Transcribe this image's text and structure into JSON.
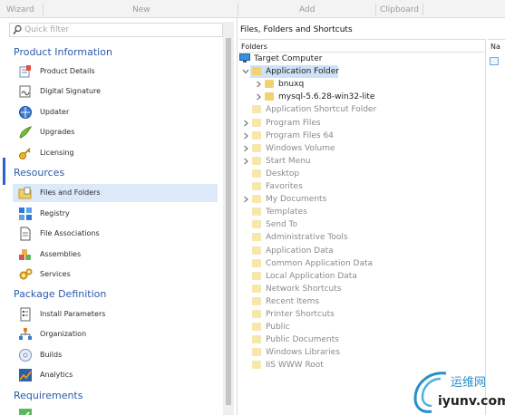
{
  "ribbon": {
    "groups": [
      "Wizard",
      "New",
      "Add",
      "Clipboard"
    ]
  },
  "sidebar": {
    "filter_placeholder": "Quick filter",
    "sections": [
      {
        "title": "Product Information",
        "items": [
          {
            "label": "Product Details",
            "icon": "product-details-icon"
          },
          {
            "label": "Digital Signature",
            "icon": "digital-signature-icon"
          },
          {
            "label": "Updater",
            "icon": "updater-icon"
          },
          {
            "label": "Upgrades",
            "icon": "upgrades-icon"
          },
          {
            "label": "Licensing",
            "icon": "licensing-icon"
          }
        ]
      },
      {
        "title": "Resources",
        "items": [
          {
            "label": "Files and Folders",
            "icon": "files-and-folders-icon",
            "selected": true
          },
          {
            "label": "Registry",
            "icon": "registry-icon"
          },
          {
            "label": "File Associations",
            "icon": "file-associations-icon"
          },
          {
            "label": "Assemblies",
            "icon": "assemblies-icon"
          },
          {
            "label": "Services",
            "icon": "services-icon"
          }
        ]
      },
      {
        "title": "Package Definition",
        "items": [
          {
            "label": "Install Parameters",
            "icon": "install-parameters-icon"
          },
          {
            "label": "Organization",
            "icon": "organization-icon"
          },
          {
            "label": "Builds",
            "icon": "builds-icon"
          },
          {
            "label": "Analytics",
            "icon": "analytics-icon"
          }
        ]
      },
      {
        "title": "Requirements",
        "items": []
      }
    ]
  },
  "main": {
    "title": "Files, Folders and Shortcuts",
    "folders_header": "Folders",
    "right_header": "Na",
    "tree": [
      {
        "label": "Target Computer",
        "level": 0,
        "kind": "computer"
      },
      {
        "label": "Application Folder",
        "level": 1,
        "chevron": "expanded",
        "selected": true
      },
      {
        "label": "bnuxq",
        "level": 2,
        "chevron": "collapsed"
      },
      {
        "label": "mysql-5.6.28-win32-lite",
        "level": 2,
        "chevron": "collapsed"
      },
      {
        "label": "Application Shortcut Folder",
        "level": 1,
        "dim": true
      },
      {
        "label": "Program Files",
        "level": 1,
        "chevron": "collapsed",
        "dim": true
      },
      {
        "label": "Program Files 64",
        "level": 1,
        "chevron": "collapsed",
        "dim": true
      },
      {
        "label": "Windows Volume",
        "level": 1,
        "chevron": "collapsed",
        "dim": true
      },
      {
        "label": "Start Menu",
        "level": 1,
        "chevron": "collapsed",
        "dim": true
      },
      {
        "label": "Desktop",
        "level": 1,
        "dim": true
      },
      {
        "label": "Favorites",
        "level": 1,
        "dim": true
      },
      {
        "label": "My Documents",
        "level": 1,
        "chevron": "collapsed",
        "dim": true
      },
      {
        "label": "Templates",
        "level": 1,
        "dim": true
      },
      {
        "label": "Send To",
        "level": 1,
        "dim": true
      },
      {
        "label": "Administrative Tools",
        "level": 1,
        "dim": true
      },
      {
        "label": "Application Data",
        "level": 1,
        "dim": true
      },
      {
        "label": "Common Application Data",
        "level": 1,
        "dim": true
      },
      {
        "label": "Local Application Data",
        "level": 1,
        "dim": true
      },
      {
        "label": "Network Shortcuts",
        "level": 1,
        "dim": true
      },
      {
        "label": "Recent Items",
        "level": 1,
        "dim": true
      },
      {
        "label": "Printer Shortcuts",
        "level": 1,
        "dim": true
      },
      {
        "label": "Public",
        "level": 1,
        "dim": true
      },
      {
        "label": "Public Documents",
        "level": 1,
        "dim": true
      },
      {
        "label": "Windows Libraries",
        "level": 1,
        "dim": true
      },
      {
        "label": "IIS WWW Root",
        "level": 1,
        "dim": true
      }
    ]
  },
  "watermark": {
    "line1": "运维网",
    "line2": "iyunv.com"
  }
}
